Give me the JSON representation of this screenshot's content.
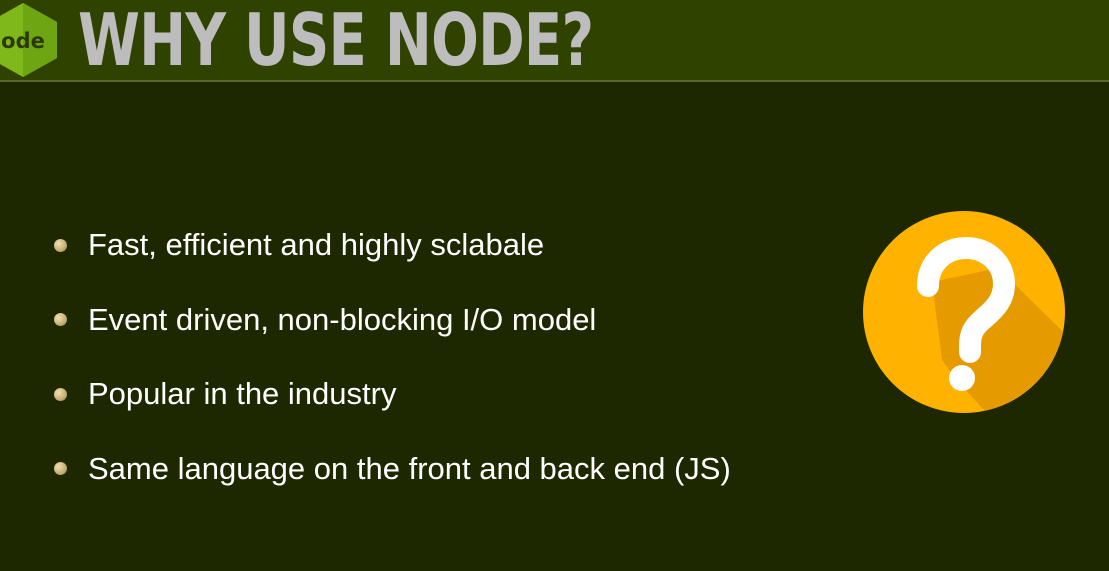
{
  "slide": {
    "title": "WHY USE NODE?",
    "logo_text": "ode",
    "bullets": [
      "Fast, efficient and highly sclabale",
      "Event driven, non-blocking I/O model",
      "Popular in the industry",
      "Same language on the front and back end (JS)"
    ]
  },
  "icons": {
    "logo": "nodejs-hexagon-logo",
    "question": "question-mark-circle-icon"
  },
  "colors": {
    "background": "#1d2800",
    "header": "#2f4200",
    "title": "#bdbdbd",
    "bullet_text": "#ffffff",
    "logo_green": "#7fb81a",
    "question_circle": "#ffb300",
    "question_shadow": "#e59b00"
  }
}
